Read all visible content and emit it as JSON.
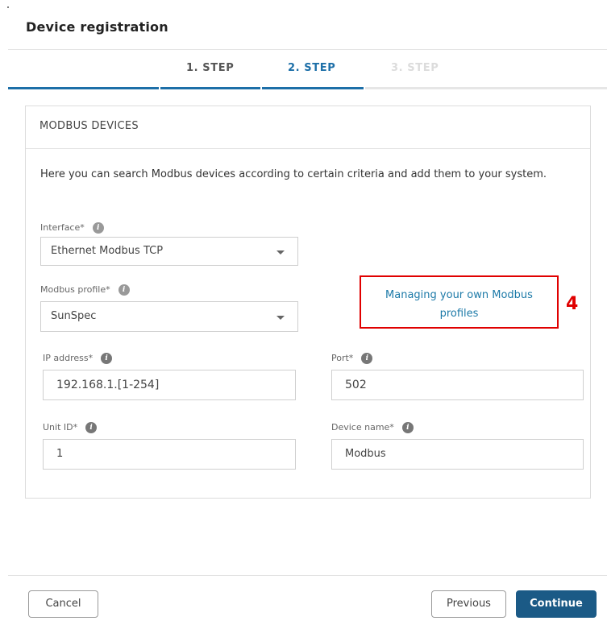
{
  "dialog": {
    "title": "Device registration"
  },
  "steps": [
    {
      "label": "1. STEP",
      "state": "done"
    },
    {
      "label": "2. STEP",
      "state": "active"
    },
    {
      "label": "3. STEP",
      "state": "future"
    }
  ],
  "colors": {
    "accent": "#1d6fa8",
    "primary_button": "#1b5a86",
    "callout": "#e00000"
  },
  "panel": {
    "title": "MODBUS DEVICES",
    "intro": "Here you can search Modbus devices according to certain criteria and add them to your system."
  },
  "form": {
    "interface": {
      "label": "Interface*",
      "value": "Ethernet Modbus TCP"
    },
    "modbus_profile": {
      "label": "Modbus profile*",
      "value": "SunSpec"
    },
    "ip_address": {
      "label": "IP address*",
      "value": "192.168.1.[1-254]"
    },
    "port": {
      "label": "Port*",
      "value": "502"
    },
    "unit_id": {
      "label": "Unit ID*",
      "value": "1"
    },
    "device_name": {
      "label": "Device name*",
      "value": "Modbus"
    }
  },
  "profiles_link": {
    "line1": "Managing your own Modbus",
    "line2": "profiles"
  },
  "callout": "4",
  "footer": {
    "cancel": "Cancel",
    "previous": "Previous",
    "continue": "Continue"
  }
}
